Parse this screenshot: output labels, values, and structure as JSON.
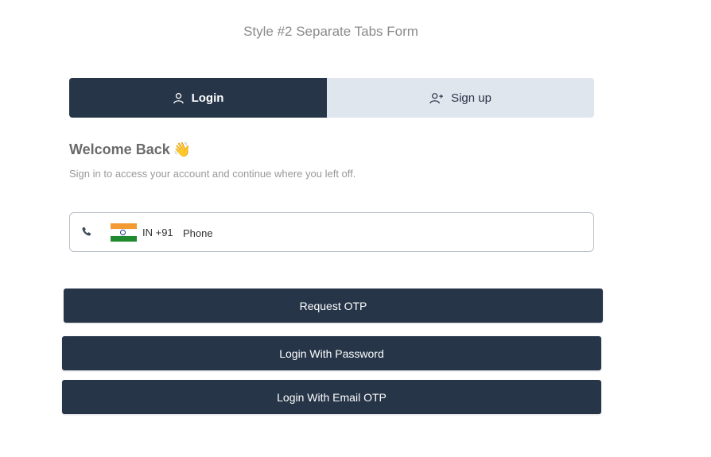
{
  "page": {
    "title": "Style #2 Separate Tabs Form"
  },
  "tabs": {
    "login_label": "Login",
    "signup_label": "Sign up"
  },
  "welcome": {
    "heading": "Welcome Back",
    "wave_emoji": "👋",
    "subtitle": "Sign in to access your account and continue where you left off."
  },
  "phone": {
    "country_code": "IN +91",
    "placeholder": "Phone",
    "value": "",
    "flag": "india-flag",
    "icon": "phone-icon"
  },
  "buttons": {
    "request_otp": "Request OTP",
    "login_password": "Login With Password",
    "login_email_otp": "Login With Email OTP"
  },
  "colors": {
    "primary": "#263548",
    "tab_inactive": "#dfe6ee",
    "muted_text": "#999999"
  }
}
